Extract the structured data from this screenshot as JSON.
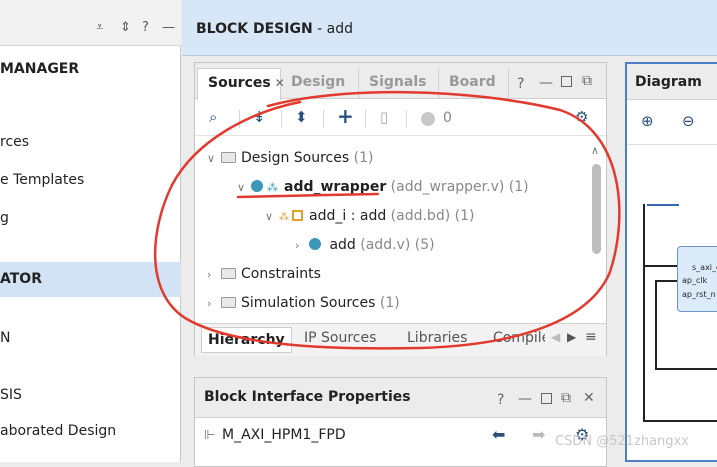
{
  "flow_navigator": {
    "section_project_manager": "MANAGER",
    "item_sources": "rces",
    "item_language_templates": "e Templates",
    "item_ip_catalog": "g",
    "section_ip_integrator": "ATOR",
    "item_create_bd": "N",
    "item_synthesis": "SIS",
    "item_open_elaborated": "aborated Design"
  },
  "header": {
    "title_bold": "BLOCK DESIGN",
    "title_rest": " - add"
  },
  "sources_panel": {
    "tabs": [
      "Sources",
      "Design",
      "Signals",
      "Board"
    ],
    "active_tab": "Sources",
    "toolbar": {
      "count": "0"
    },
    "tree": {
      "design_sources": "Design Sources",
      "design_sources_count": "(1)",
      "wrapper_name": "add_wrapper",
      "wrapper_file": "(add_wrapper.v)",
      "wrapper_count": "(1)",
      "add_i_name": "add_i : add",
      "add_i_file": "(add.bd)",
      "add_i_count": "(1)",
      "add_name": "add",
      "add_file": "(add.v)",
      "add_count": "(5)",
      "constraints": "Constraints",
      "sim_sources": "Simulation Sources",
      "sim_sources_count": "(1)"
    },
    "bottom_tabs": [
      "Hierarchy",
      "IP Sources",
      "Libraries",
      "Compile"
    ]
  },
  "block_interface_properties": {
    "title": "Block Interface Properties",
    "interface_name": "M_AXI_HPM1_FPD"
  },
  "diagram": {
    "title": "Diagram",
    "port_labels": [
      "s_axi_c",
      "ap_clk",
      "ap_rst_n"
    ]
  },
  "watermark": "CSDN @521zhangxx",
  "colors": {
    "header_bg": "#d7e7f8",
    "selected_bg": "#d2e3f6",
    "annotation": "#e23a2e",
    "diagram_border": "#4d7fc4"
  }
}
